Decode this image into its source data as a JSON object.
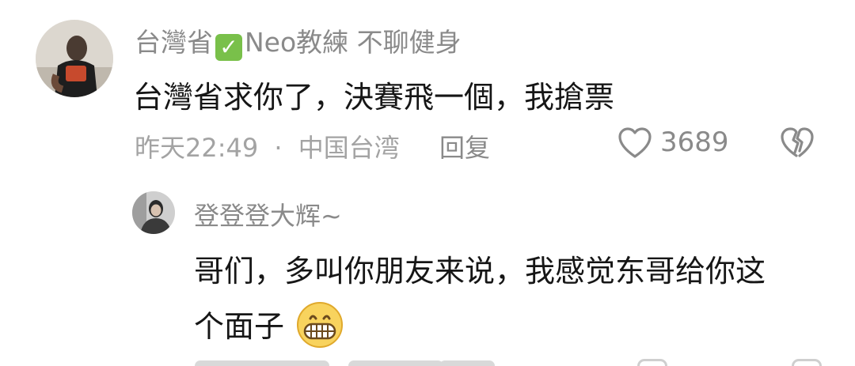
{
  "comment": {
    "username_prefix": "台灣省",
    "username_badge": "✓",
    "username_suffix": "Neo教練 不聊健身",
    "text": "台灣省求你了，決賽飛一個，我搶票",
    "time": "昨天22:49",
    "separator": "·",
    "location": "中国台湾",
    "reply_label": "回复",
    "like_count": "3689",
    "avatar_icon": "profile-photo-icon"
  },
  "reply": {
    "username": "登登登大辉~",
    "text_line1": "哥们，多叫你朋友来说，我感觉东哥给你这",
    "text_line2": "个面子",
    "emoji": "grinning-face-icon",
    "avatar_icon": "profile-photo-icon"
  },
  "colors": {
    "username": "#8a8a8a",
    "comment_text": "#161616",
    "meta": "#a3a3a3",
    "emoji_fill": "#f8d35e"
  }
}
